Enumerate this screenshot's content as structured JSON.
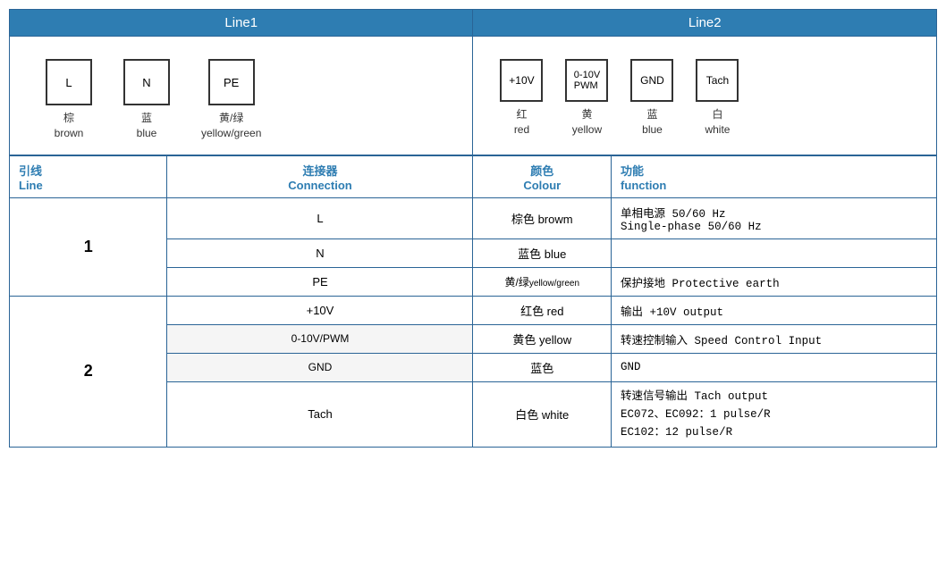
{
  "header": {
    "line1": "Line1",
    "line2": "Line2"
  },
  "line1_connectors": [
    {
      "label": "L",
      "color_zh": "棕",
      "color_en": "brown"
    },
    {
      "label": "N",
      "color_zh": "蓝",
      "color_en": "blue"
    },
    {
      "label": "PE",
      "color_zh": "黄/绿",
      "color_en": "yellow/green"
    }
  ],
  "line2_connectors": [
    {
      "label": "+10V",
      "color_zh": "红",
      "color_en": "red"
    },
    {
      "label": "0-10V\nPWM",
      "color_zh": "黄",
      "color_en": "yellow"
    },
    {
      "label": "GND",
      "color_zh": "蓝",
      "color_en": "blue"
    },
    {
      "label": "Tach",
      "color_zh": "白",
      "color_en": "white"
    }
  ],
  "table_headers": {
    "line_zh": "引线",
    "line_en": "Line",
    "connection_zh": "连接器",
    "connection_en": "Connection",
    "colour_zh": "颜色",
    "colour_en": "Colour",
    "function_zh": "功能",
    "function_en": "function"
  },
  "rows": [
    {
      "line": "1",
      "line_rowspan": 3,
      "connection": "L",
      "colour": "棕色 browm",
      "function": "单相电源 50/60 Hz\nSingle-phase 50/60 Hz",
      "function_line2": ""
    },
    {
      "line": "",
      "connection": "N",
      "colour": "蓝色 blue",
      "function": ""
    },
    {
      "line": "",
      "connection": "PE",
      "colour": "黄/绿yellow/green",
      "function": "保护接地 Protective earth"
    },
    {
      "line": "2",
      "line_rowspan": 4,
      "connection": "+10V",
      "colour": "红色 red",
      "function": "输出 +10V output"
    },
    {
      "line": "",
      "connection": "0-10V/PWM",
      "colour": "黄色 yellow",
      "function": "转速控制输入 Speed Control Input"
    },
    {
      "line": "",
      "connection": "GND",
      "colour": "蓝色",
      "function": "GND"
    },
    {
      "line": "",
      "connection": "Tach",
      "colour": "白色 white",
      "function": "转速信号输出 Tach output\nEC072、EC092：1 pulse/R\nEC102：12 pulse/R"
    }
  ]
}
